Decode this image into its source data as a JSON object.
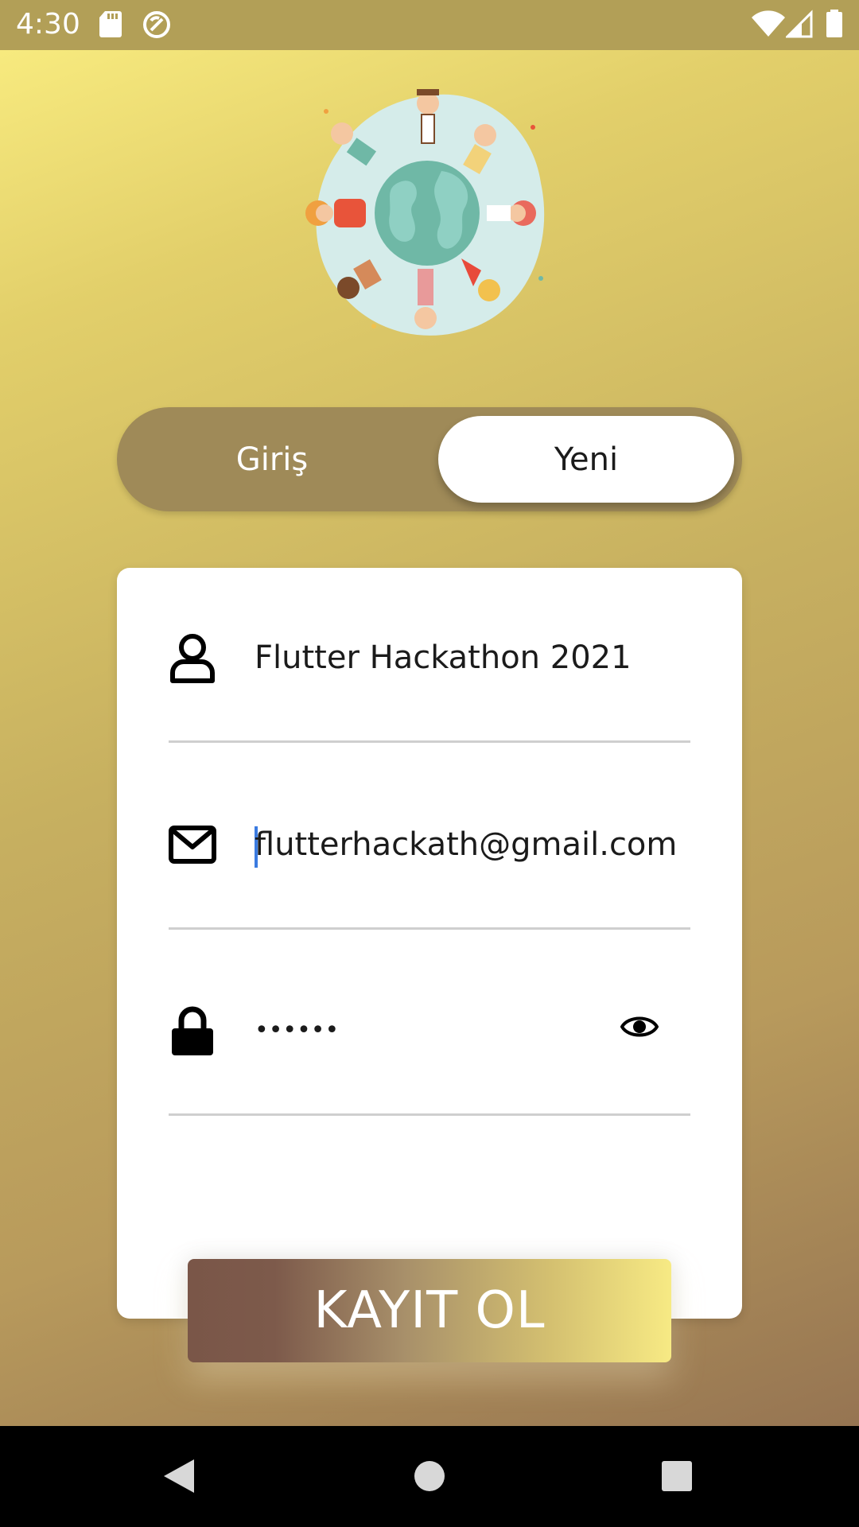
{
  "status_bar": {
    "time": "4:30"
  },
  "auth_toggle": {
    "login_label": "Giriş",
    "signup_label": "Yeni",
    "active": "signup"
  },
  "form": {
    "name_value": "Flutter Hackathon 2021",
    "email_value": "flutterhackath@gmail.com",
    "password_mask": "••••••"
  },
  "submit_label": "KAYIT OL",
  "colors": {
    "accent_toggle": "#9f8a58",
    "button_start": "#7a5648",
    "button_end": "#f7ea84",
    "caret": "#3b7be0"
  }
}
